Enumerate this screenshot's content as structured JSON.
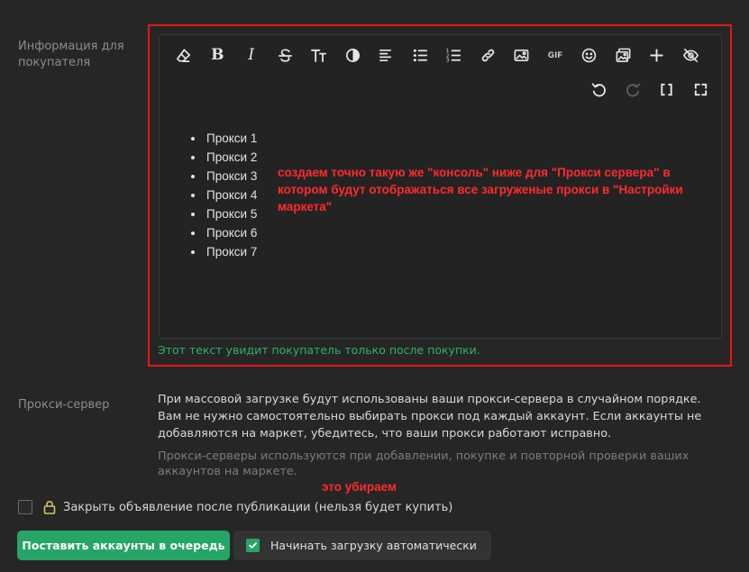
{
  "buyer_info": {
    "label": "Информация для покупателя",
    "toolbar_row1": [
      {
        "icon": "eraser-icon"
      },
      {
        "icon": "bold-icon",
        "text": "B"
      },
      {
        "icon": "italic-icon",
        "text": "I"
      },
      {
        "icon": "strikethrough-icon"
      },
      {
        "icon": "text-size-icon"
      },
      {
        "icon": "contrast-icon"
      },
      {
        "icon": "align-left-icon"
      },
      {
        "icon": "bullet-list-icon"
      },
      {
        "icon": "numbered-list-icon"
      },
      {
        "icon": "link-icon"
      },
      {
        "icon": "image-icon"
      },
      {
        "icon": "gif-icon",
        "text": "GIF"
      },
      {
        "icon": "emoji-icon"
      },
      {
        "icon": "gallery-icon"
      },
      {
        "icon": "plus-icon"
      },
      {
        "icon": "hidden-eye-icon"
      }
    ],
    "toolbar_row2": [
      {
        "icon": "undo-icon"
      },
      {
        "icon": "redo-icon",
        "disabled": true
      },
      {
        "icon": "source-brackets-icon"
      },
      {
        "icon": "fullscreen-icon"
      }
    ],
    "proxy_items": [
      "Прокси 1",
      "Прокси 2",
      "Прокси 3",
      "Прокси 4",
      "Прокси 5",
      "Прокси 6",
      "Прокси 7"
    ],
    "annotation": "создаем точно такую же \"консоль\" ниже для \"Прокси сервера\" в котором будут отображаться все загруженые прокси в \"Настройки маркета\"",
    "hint": "Этот текст увидит покупатель только после покупки."
  },
  "proxy_server": {
    "label": "Прокси-сервер",
    "description": "При массовой загрузке будут использованы ваши прокси-сервера в случайном порядке. Вам не нужно самостоятельно выбирать прокси под каждый аккаунт. Если аккаунты не добавляются на маркет, убедитесь, что ваши прокси работают исправно.",
    "muted_note": "Прокси-серверы используются при добавлении, покупке и повторной проверки ваших аккаунтов на маркете.",
    "remove_annotation": "это убираем"
  },
  "close_listing": {
    "label": "Закрыть объявление после публикации (нельзя будет купить)",
    "checked": false
  },
  "actions": {
    "queue_button": "Поставить аккаунты в очередь",
    "auto_label": "Начинать загрузку автоматически",
    "auto_checked": true
  },
  "colors": {
    "background": "#262626",
    "accent_green": "#25a566",
    "hint_green": "#2fb06a",
    "annotation_red": "#ff2b2b",
    "highlight_border": "#e8151b"
  }
}
